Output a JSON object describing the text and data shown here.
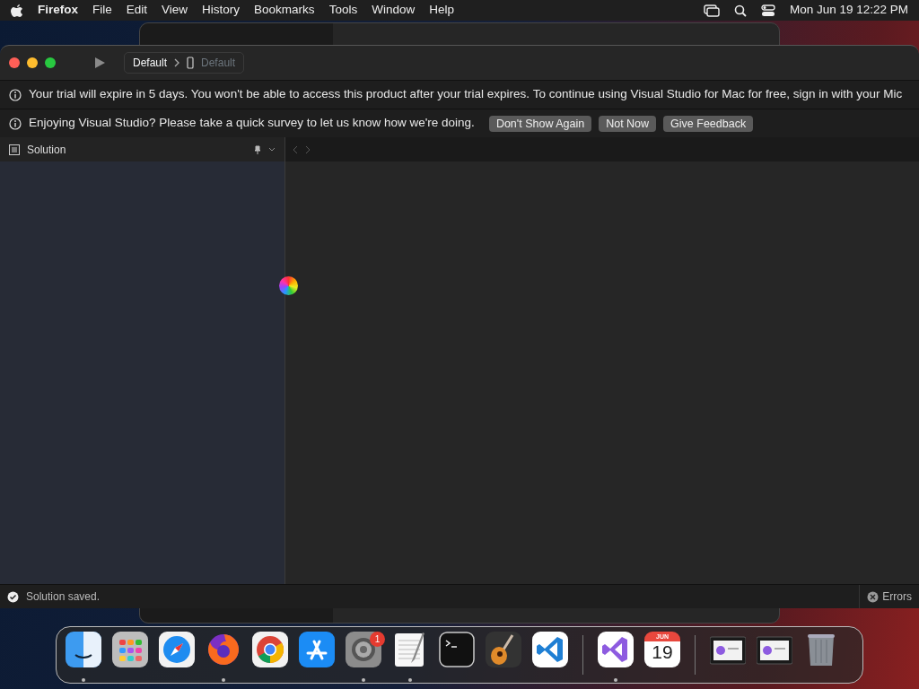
{
  "menu_bar": {
    "app": "Firefox",
    "items": [
      "File",
      "Edit",
      "View",
      "History",
      "Bookmarks",
      "Tools",
      "Window",
      "Help"
    ],
    "clock": "Mon Jun 19  12:22 PM"
  },
  "toolbar": {
    "configuration": "Default",
    "device": "Default"
  },
  "info_bars": [
    {
      "text": "Your trial will expire in 5 days. You won't be able to access this product after your trial expires. To continue using Visual Studio for Mac for free, sign in with your Mic"
    },
    {
      "text": "Enjoying Visual Studio? Please take a quick survey to let us know how we're doing.",
      "buttons": [
        "Don't Show Again",
        "Not Now",
        "Give Feedback"
      ]
    }
  ],
  "solution_pad": {
    "title": "Solution"
  },
  "status_bar": {
    "message": "Solution saved.",
    "errors": "Errors"
  },
  "dock": [
    {
      "kind": "finder",
      "running": true
    },
    {
      "kind": "launchpad",
      "running": false
    },
    {
      "kind": "safari",
      "running": false
    },
    {
      "kind": "firefox",
      "running": true
    },
    {
      "kind": "chrome",
      "running": false
    },
    {
      "kind": "appstore",
      "running": false
    },
    {
      "kind": "settings",
      "running": true,
      "badge": "1"
    },
    {
      "kind": "textedit",
      "running": true
    },
    {
      "kind": "terminal",
      "running": false
    },
    {
      "kind": "garageband",
      "running": false
    },
    {
      "kind": "vscode",
      "running": false
    },
    {
      "kind": "separator"
    },
    {
      "kind": "visualstudio",
      "running": true
    },
    {
      "kind": "calendar",
      "running": false,
      "month": "JUN",
      "day": "19"
    },
    {
      "kind": "separator"
    },
    {
      "kind": "window",
      "running": false
    },
    {
      "kind": "window",
      "running": false
    },
    {
      "kind": "trash",
      "running": false
    }
  ]
}
